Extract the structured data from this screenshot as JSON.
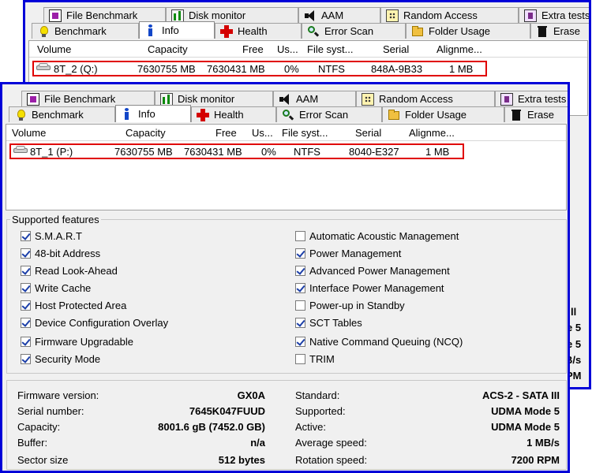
{
  "tabs_row1": [
    {
      "label": "File Benchmark",
      "icon": "file-benchmark-icon"
    },
    {
      "label": "Disk monitor",
      "icon": "disk-monitor-icon"
    },
    {
      "label": "AAM",
      "icon": "speaker-icon"
    },
    {
      "label": "Random Access",
      "icon": "random-access-icon"
    },
    {
      "label": "Extra tests",
      "icon": "extra-tests-icon"
    }
  ],
  "tabs_row2": [
    {
      "label": "Benchmark",
      "icon": "lightbulb-icon"
    },
    {
      "label": "Info",
      "icon": "info-icon",
      "active": true
    },
    {
      "label": "Health",
      "icon": "red-cross-icon"
    },
    {
      "label": "Error Scan",
      "icon": "magnifier-icon"
    },
    {
      "label": "Folder Usage",
      "icon": "folder-icon"
    },
    {
      "label": "Erase",
      "icon": "trash-icon"
    }
  ],
  "columns": [
    "Volume",
    "Capacity",
    "Free",
    "Us...",
    "File syst...",
    "Serial",
    "Alignme..."
  ],
  "back_window": {
    "volume_row": {
      "volume": "8T_2 (Q:)",
      "capacity": "7630755 MB",
      "free": "7630431 MB",
      "used": "0%",
      "fs": "NTFS",
      "serial": "848A-9B33",
      "alignment": "1 MB"
    },
    "visible_values_edge": [
      "ll",
      "e 5",
      "e 5",
      "B/s",
      "PM"
    ]
  },
  "front_window": {
    "volume_row": {
      "volume": "8T_1 (P:)",
      "capacity": "7630755 MB",
      "free": "7630431 MB",
      "used": "0%",
      "fs": "NTFS",
      "serial": "8040-E327",
      "alignment": "1 MB"
    },
    "features_title": "Supported features",
    "features_left": [
      {
        "label": "S.M.A.R.T",
        "checked": true
      },
      {
        "label": "48-bit Address",
        "checked": true
      },
      {
        "label": "Read Look-Ahead",
        "checked": true
      },
      {
        "label": "Write Cache",
        "checked": true
      },
      {
        "label": "Host Protected Area",
        "checked": true
      },
      {
        "label": "Device Configuration Overlay",
        "checked": true
      },
      {
        "label": "Firmware Upgradable",
        "checked": true
      },
      {
        "label": "Security Mode",
        "checked": true
      }
    ],
    "features_right": [
      {
        "label": "Automatic Acoustic Management",
        "checked": false
      },
      {
        "label": "Power Management",
        "checked": true
      },
      {
        "label": "Advanced Power Management",
        "checked": true
      },
      {
        "label": "Interface Power Management",
        "checked": true
      },
      {
        "label": "Power-up in Standby",
        "checked": false
      },
      {
        "label": "SCT Tables",
        "checked": true
      },
      {
        "label": "Native Command Queuing (NCQ)",
        "checked": true
      },
      {
        "label": "TRIM",
        "checked": false
      }
    ],
    "info_left": [
      {
        "label": "Firmware version:",
        "value": "GX0A"
      },
      {
        "label": "Serial number:",
        "value": "7645K047FUUD"
      },
      {
        "label": "Capacity:",
        "value": "8001.6 gB (7452.0 GB)"
      },
      {
        "label": "Buffer:",
        "value": "n/a"
      },
      {
        "label": "Sector size",
        "value": "512 bytes"
      }
    ],
    "info_right": [
      {
        "label": "Standard:",
        "value": "ACS-2 - SATA III"
      },
      {
        "label": "Supported:",
        "value": "UDMA Mode 5"
      },
      {
        "label": "Active:",
        "value": "UDMA Mode 5"
      },
      {
        "label": "Average speed:",
        "value": "1 MB/s"
      },
      {
        "label": "Rotation speed:",
        "value": "7200 RPM"
      }
    ]
  },
  "colors": {
    "window_border": "#0000d8",
    "highlight": "#e00000",
    "check": "#1c3fa8"
  }
}
